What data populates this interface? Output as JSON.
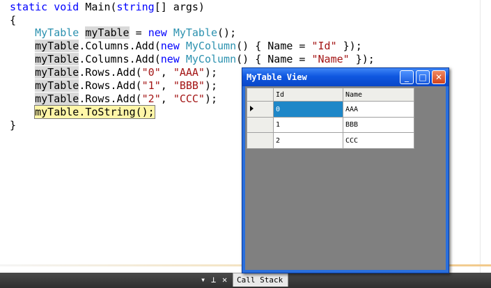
{
  "editor": {
    "line1": {
      "kw1": "static",
      "kw2": "void",
      "name": " Main(",
      "kw3": "string",
      "rest": "[] args)"
    },
    "line2": "{",
    "line3": {
      "type1": "MyTable",
      "var": "myTable",
      "eq": " = ",
      "kw": "new",
      "type2": "MyTable",
      "end": "();"
    },
    "line4": {
      "obj": "myTable",
      "mid": ".Columns.Add(",
      "kw": "new",
      "type": "MyColumn",
      "open": "() { Name = ",
      "str": "\"Id\"",
      "close": " });"
    },
    "line5": {
      "obj": "myTable",
      "mid": ".Columns.Add(",
      "kw": "new",
      "type": "MyColumn",
      "open": "() { Name = ",
      "str": "\"Name\"",
      "close": " });"
    },
    "line6": {
      "obj": "myTable",
      "mid": ".Rows.Add(",
      "s1": "\"0\"",
      "sep": ", ",
      "s2": "\"AAA\"",
      "end": ");"
    },
    "line7": {
      "obj": "myTable",
      "mid": ".Rows.Add(",
      "s1": "\"1\"",
      "sep": ", ",
      "s2": "\"BBB\"",
      "end": ");"
    },
    "line8": {
      "obj": "myTable",
      "mid": ".Rows.Add(",
      "s1": "\"2\"",
      "sep": ", ",
      "s2": "\"CCC\"",
      "end": ");"
    },
    "line9": {
      "obj": "myTable",
      "call": ".ToString();"
    },
    "line10": "}"
  },
  "window": {
    "title": "MyTable View",
    "minimize": "_",
    "maximize": "□",
    "close": "✕",
    "grid": {
      "columns": [
        "Id",
        "Name"
      ],
      "rows": [
        {
          "id": "0",
          "name": "AAA"
        },
        {
          "id": "1",
          "name": "BBB"
        },
        {
          "id": "2",
          "name": "CCC"
        }
      ]
    }
  },
  "statusbar": {
    "dropdown_icon": "▾",
    "pin_icon": "⊥",
    "close_icon": "✕",
    "tab_label": "Call Stack"
  }
}
